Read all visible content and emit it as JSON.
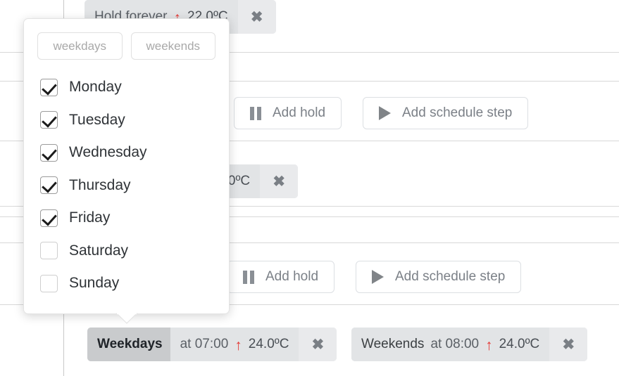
{
  "schedule_rows": [
    {
      "chip": {
        "label": "Hold forever",
        "label_strong": false,
        "time_text": "",
        "arrow": "up-arrow-icon",
        "temperature": "22.0ºC",
        "close": "✖"
      },
      "actions": []
    },
    {
      "chip": null,
      "actions": [
        {
          "icon": "pause-icon",
          "label": "Add hold"
        },
        {
          "icon": "play-icon",
          "label": "Add schedule step"
        }
      ]
    },
    {
      "chip": {
        "label": "",
        "label_strong": false,
        "time_text": "",
        "arrow": "up-arrow-icon",
        "temperature": "23.0ºC",
        "close": "✖"
      },
      "actions": []
    },
    {
      "chip": null,
      "actions": [
        {
          "icon": "pause-icon",
          "label": "Add hold"
        },
        {
          "icon": "play-icon",
          "label": "Add schedule step"
        }
      ]
    }
  ],
  "bottom_chips": [
    {
      "label": "Weekdays",
      "label_strong": true,
      "time_text": "at 07:00",
      "arrow": "up-arrow-icon",
      "temperature": "24.0ºC",
      "close": "✖"
    },
    {
      "label": "Weekends",
      "label_strong": false,
      "time_text": "at 08:00",
      "arrow": "up-arrow-icon",
      "temperature": "24.0ºC",
      "close": "✖"
    }
  ],
  "day_picker": {
    "presets": [
      {
        "label": "weekdays"
      },
      {
        "label": "weekends"
      }
    ],
    "days": [
      {
        "label": "Monday",
        "checked": true
      },
      {
        "label": "Tuesday",
        "checked": true
      },
      {
        "label": "Wednesday",
        "checked": true
      },
      {
        "label": "Thursday",
        "checked": true
      },
      {
        "label": "Friday",
        "checked": true
      },
      {
        "label": "Saturday",
        "checked": false
      },
      {
        "label": "Sunday",
        "checked": false
      }
    ]
  },
  "colors": {
    "arrow_red": "#e53935",
    "chip_bg": "#e2e4e6",
    "chip_highlight_bg": "#c9cbcd",
    "divider": "#d8d8d8"
  },
  "glyphs": {
    "up_arrow": "↑",
    "close": "✖"
  }
}
